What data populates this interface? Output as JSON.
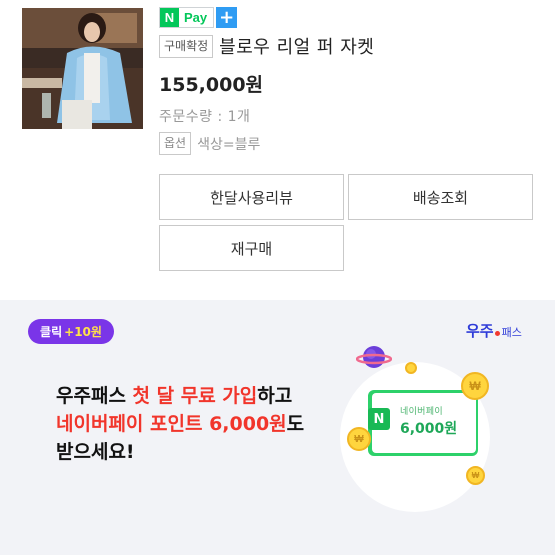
{
  "order": {
    "image_alt": "product photo",
    "npay": {
      "n": "N",
      "pay": "Pay",
      "plus": "+"
    },
    "status_tag": "구매확정",
    "product_title": "블로우 리얼 퍼 자켓",
    "price": "155,000원",
    "quantity": "주문수량 : 1개",
    "option_tag": "옵션",
    "option_value": "색상=블루",
    "buttons": {
      "review": "한달사용리뷰",
      "shipping": "배송조회",
      "rebuy": "재구매"
    }
  },
  "ad": {
    "click_badge": {
      "label": "클릭",
      "points": "+10원"
    },
    "logo": {
      "main": "우주",
      "sub": "패스"
    },
    "headline": {
      "line1_a": "우주패스 ",
      "line1_red": "첫 달 무료 가입",
      "line1_b": "하고",
      "line2_red": "네이버페이 포인트 6,000원",
      "line2_b": "도",
      "line3": "받으세요!"
    },
    "card": {
      "icon": "N",
      "label": "네이버페이",
      "amount": "6,000원"
    },
    "coin_symbol": "₩"
  },
  "colors": {
    "naver_green": "#03c75a",
    "plus_blue": "#2f9cf3",
    "badge_purple": "#7a35e8",
    "accent_red": "#f1352b",
    "logo_blue": "#2e3bd8"
  }
}
